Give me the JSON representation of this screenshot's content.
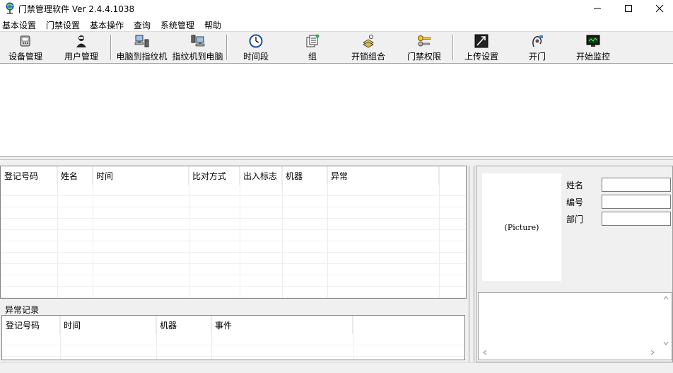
{
  "window": {
    "title": "门禁管理软件  Ver 2.4.4.1038",
    "minimize": "—",
    "maximize": "☐",
    "close": "✕"
  },
  "menu": [
    "基本设置",
    "门禁设置",
    "基本操作",
    "查询",
    "系统管理",
    "帮助"
  ],
  "toolbar": [
    {
      "label": "设备管理",
      "icon": "device-icon"
    },
    {
      "label": "用户管理",
      "icon": "user-icon"
    },
    {
      "label": "电脑到指纹机",
      "icon": "pc-to-fingerprint-icon"
    },
    {
      "label": "指纹机到电脑",
      "icon": "fingerprint-to-pc-icon"
    },
    {
      "label": "时间段",
      "icon": "clock-icon"
    },
    {
      "label": "组",
      "icon": "group-icon"
    },
    {
      "label": "开锁组合",
      "icon": "unlock-combo-icon"
    },
    {
      "label": "门禁权限",
      "icon": "key-icon"
    },
    {
      "label": "上传设置",
      "icon": "upload-icon"
    },
    {
      "label": "开门",
      "icon": "open-door-icon"
    },
    {
      "label": "开始监控",
      "icon": "monitor-icon"
    }
  ],
  "records_table": {
    "columns": [
      "登记号码",
      "姓名",
      "时间",
      "比对方式",
      "出入标志",
      "机器",
      "异常"
    ]
  },
  "exception_section": {
    "label": "异常记录",
    "columns": [
      "登记号码",
      "时间",
      "机器",
      "事件"
    ]
  },
  "person_panel": {
    "picture_text": "(Picture)",
    "name_label": "姓名",
    "id_label": "编号",
    "dept_label": "部门",
    "name_value": "",
    "id_value": "",
    "dept_value": ""
  },
  "colors": {
    "window_bg": "#f0f0f0",
    "content_bg": "#ffffff",
    "border": "#828282"
  }
}
